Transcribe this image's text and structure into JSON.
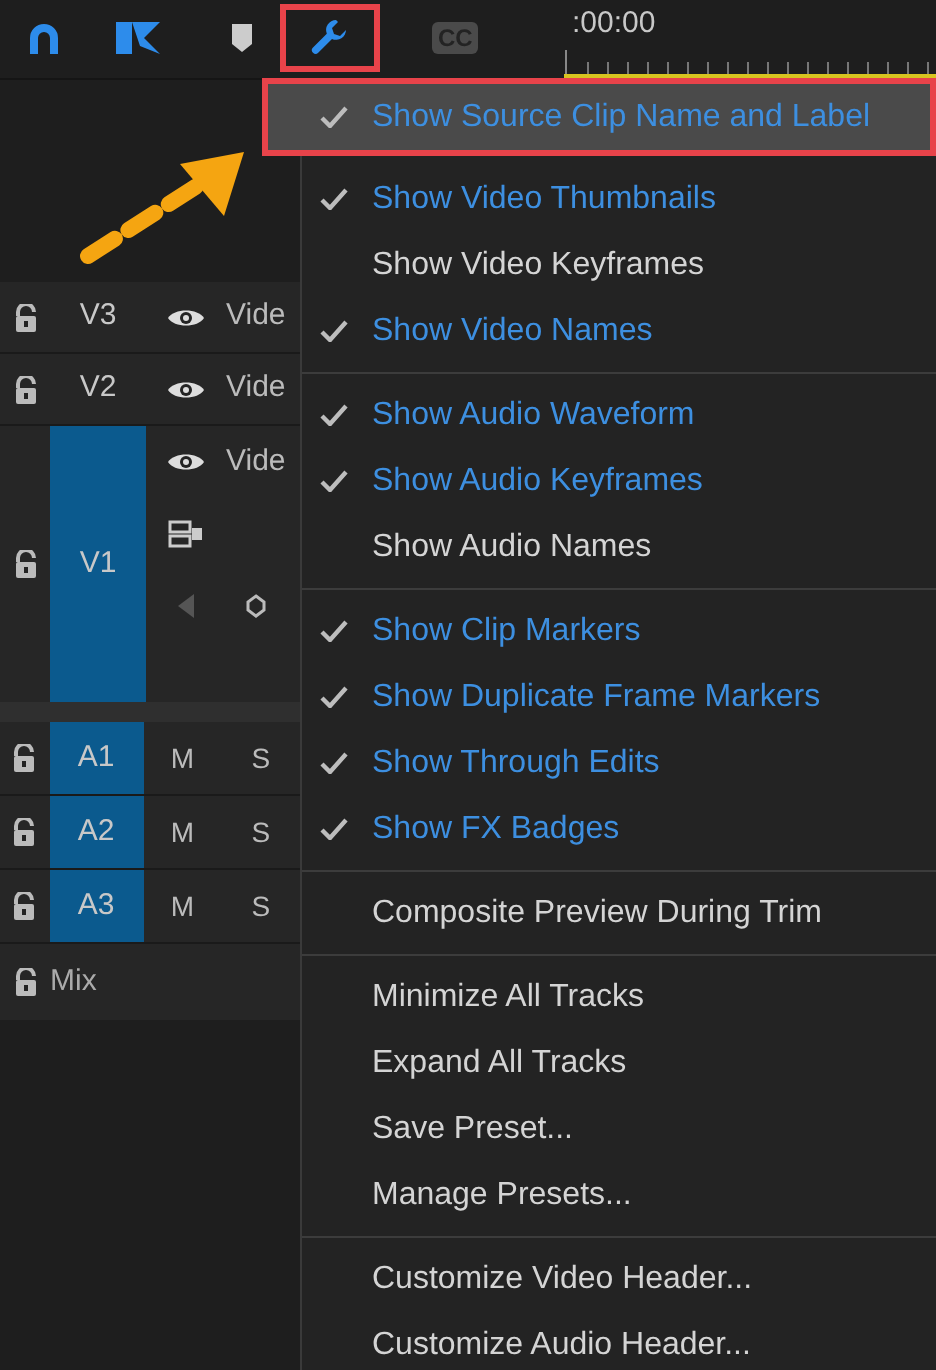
{
  "toolbar": {
    "timecode": ":00:00",
    "wrench_highlighted": true,
    "captions": "CC"
  },
  "tracks": [
    {
      "name": "V3",
      "kind": "video",
      "selected": false,
      "clip_label": "Vide"
    },
    {
      "name": "V2",
      "kind": "video",
      "selected": false,
      "clip_label": "Vide"
    },
    {
      "name": "V1",
      "kind": "video_expanded",
      "selected": true,
      "clip_label": "Vide"
    },
    {
      "name": "A1",
      "kind": "audio",
      "selected": true,
      "mute": "M",
      "solo": "S"
    },
    {
      "name": "A2",
      "kind": "audio",
      "selected": true,
      "mute": "M",
      "solo": "S"
    },
    {
      "name": "A3",
      "kind": "audio",
      "selected": true,
      "mute": "M",
      "solo": "S"
    },
    {
      "name": "Mix",
      "kind": "mix",
      "selected": false
    }
  ],
  "menu": {
    "groups": [
      [
        {
          "label": "Show Source Clip Name and Label",
          "checked": true,
          "highlighted": true
        },
        {
          "label": "Show Video Thumbnails",
          "checked": true,
          "highlighted": false
        },
        {
          "label": "Show Video Keyframes",
          "checked": false,
          "highlighted": false
        },
        {
          "label": "Show Video Names",
          "checked": true,
          "highlighted": false
        }
      ],
      [
        {
          "label": "Show Audio Waveform",
          "checked": true,
          "highlighted": false
        },
        {
          "label": "Show Audio Keyframes",
          "checked": true,
          "highlighted": false
        },
        {
          "label": "Show Audio Names",
          "checked": false,
          "highlighted": false
        }
      ],
      [
        {
          "label": "Show Clip Markers",
          "checked": true,
          "highlighted": false
        },
        {
          "label": "Show Duplicate Frame Markers",
          "checked": true,
          "highlighted": false
        },
        {
          "label": "Show Through Edits",
          "checked": true,
          "highlighted": false
        },
        {
          "label": "Show FX Badges",
          "checked": true,
          "highlighted": false
        }
      ],
      [
        {
          "label": "Composite Preview During Trim",
          "checked": false,
          "highlighted": false
        }
      ],
      [
        {
          "label": "Minimize All Tracks",
          "checked": false,
          "highlighted": false
        },
        {
          "label": "Expand All Tracks",
          "checked": false,
          "highlighted": false
        },
        {
          "label": "Save Preset...",
          "checked": false,
          "highlighted": false
        },
        {
          "label": "Manage Presets...",
          "checked": false,
          "highlighted": false
        }
      ],
      [
        {
          "label": "Customize Video Header...",
          "checked": false,
          "highlighted": false
        },
        {
          "label": "Customize Audio Header...",
          "checked": false,
          "highlighted": false
        }
      ]
    ]
  }
}
